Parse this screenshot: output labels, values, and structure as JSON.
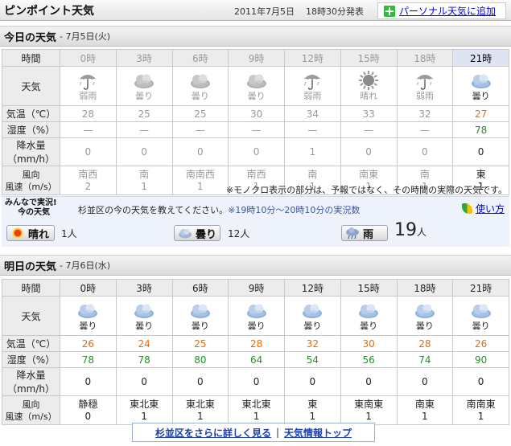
{
  "header": {
    "title": "ピンポイント天気",
    "issued_date": "2011年7月5日",
    "issued_time": "18時30分発表",
    "personal_button": "パーソナル天気に追加"
  },
  "today": {
    "title": "今日の天気",
    "date": "- 7月5日(火)",
    "labels": {
      "time": "時間",
      "weather": "天気",
      "temp": "気温（℃）",
      "humidity": "湿度（%）",
      "precip": "降水量（mm/h）",
      "wind_dir": "風向",
      "wind_speed": "風速（m/s）"
    },
    "times": [
      "0時",
      "3時",
      "6時",
      "9時",
      "12時",
      "15時",
      "18時",
      "21時"
    ],
    "weather_icons": [
      "umbrella-icon",
      "cloud-icon",
      "cloud-icon",
      "cloud-icon",
      "umbrella-icon",
      "sun-icon",
      "umbrella-icon",
      "cloud-icon"
    ],
    "weather": [
      "弱雨",
      "曇り",
      "曇り",
      "曇り",
      "弱雨",
      "晴れ",
      "弱雨",
      "曇り"
    ],
    "temp": [
      "28",
      "25",
      "25",
      "30",
      "34",
      "33",
      "32",
      "27"
    ],
    "humidity": [
      "—",
      "—",
      "—",
      "—",
      "—",
      "—",
      "—",
      "78"
    ],
    "precip": [
      "0",
      "0",
      "0",
      "0",
      "1",
      "0",
      "0",
      "0"
    ],
    "wind_dir": [
      "南西",
      "南",
      "南南西",
      "南西",
      "南",
      "南東",
      "南",
      "東"
    ],
    "wind_speed": [
      "2",
      "1",
      "1",
      "1",
      "1",
      "1",
      "1",
      "1"
    ],
    "note": "※モノクロ表示の部分は、予報ではなく、その時間の実際の天気です。"
  },
  "live": {
    "badge_line1": "みんなで実況!",
    "badge_line2": "今の天気",
    "prompt": "杉並区の今の天気を教えてください。",
    "range": "※19時10分～20時10分の実況数",
    "howto": "使い方",
    "votes": [
      {
        "label": "晴れ",
        "count": "1人",
        "icon": "sun-icon"
      },
      {
        "label": "曇り",
        "count": "12人",
        "icon": "cloud-icon"
      },
      {
        "label": "雨",
        "count": "19",
        "unit": "人",
        "icon": "rain-icon"
      }
    ]
  },
  "tomorrow": {
    "title": "明日の天気",
    "date": "- 7月6日(水)",
    "labels": {
      "time": "時間",
      "weather": "天気",
      "temp": "気温（℃）",
      "humidity": "湿度（%）",
      "precip": "降水量（mm/h）",
      "wind_dir": "風向",
      "wind_speed": "風速（m/s）"
    },
    "times": [
      "0時",
      "3時",
      "6時",
      "9時",
      "12時",
      "15時",
      "18時",
      "21時"
    ],
    "weather_icons": [
      "cloud-icon",
      "cloud-icon",
      "cloud-icon",
      "cloud-icon",
      "cloud-icon",
      "cloud-icon",
      "cloud-icon",
      "cloud-icon"
    ],
    "weather": [
      "曇り",
      "曇り",
      "曇り",
      "曇り",
      "曇り",
      "曇り",
      "曇り",
      "曇り"
    ],
    "temp": [
      "26",
      "24",
      "25",
      "28",
      "32",
      "30",
      "28",
      "26"
    ],
    "humidity": [
      "78",
      "78",
      "80",
      "64",
      "54",
      "56",
      "74",
      "90"
    ],
    "precip": [
      "0",
      "0",
      "0",
      "0",
      "0",
      "0",
      "0",
      "0"
    ],
    "wind_dir": [
      "静穏",
      "東北東",
      "東北東",
      "東北東",
      "東",
      "東南東",
      "南東",
      "南南東"
    ],
    "wind_speed": [
      "0",
      "1",
      "1",
      "1",
      "1",
      "1",
      "1",
      "1"
    ]
  },
  "footer": {
    "link1": "杉並区をさらに詳しく見る",
    "separator": "|",
    "link2": "天気情報トップ"
  },
  "colors": {
    "temp": "#ee6a00",
    "humidity": "#1a9a1a",
    "link": "#1a3fb0",
    "current_column": "#dde4f4"
  }
}
